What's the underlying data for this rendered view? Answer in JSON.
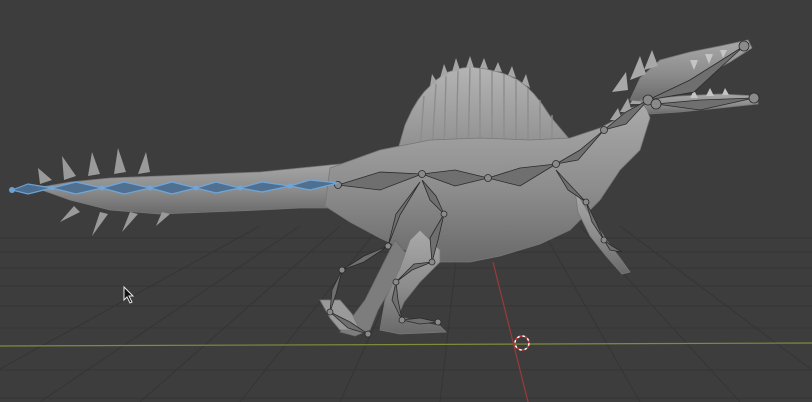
{
  "viewport": {
    "background": "#3d3d3d",
    "grid_color": "#353535",
    "x_axis_color": "#7e8c3b",
    "y_axis_color": "#9a3a3a",
    "model": "spinosaurus-sculpt-mesh",
    "mesh_color": "#8e8e8e",
    "bone_color": "#6f6f6f",
    "selected_bone_color": "#6ea8dc",
    "icons": [
      "mouse-cursor-icon",
      "3d-cursor-icon"
    ]
  }
}
